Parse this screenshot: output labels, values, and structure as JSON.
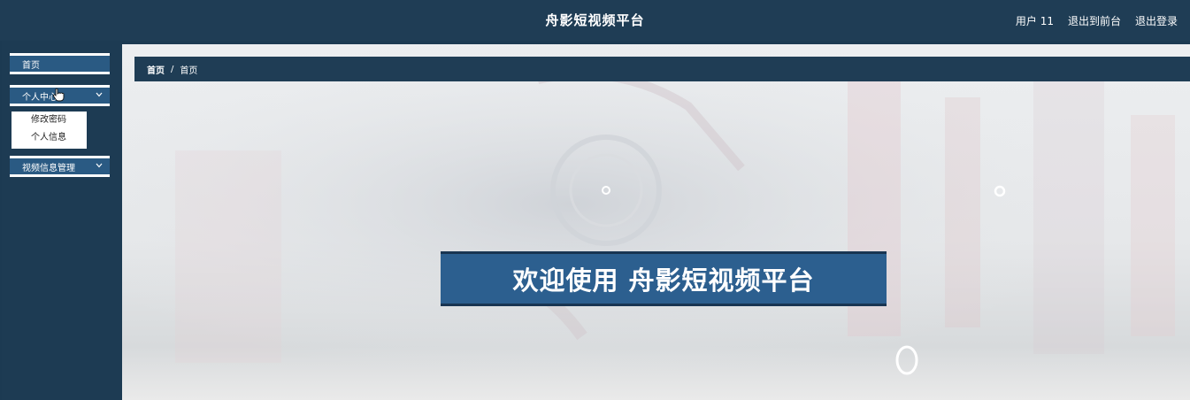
{
  "header": {
    "title": "舟影短视频平台",
    "user_label": "用户 11",
    "front_link": "退出到前台",
    "logout_link": "退出登录"
  },
  "sidebar": {
    "items": [
      {
        "label": "首页"
      },
      {
        "label": "个人中心",
        "icon": "chevron-down-icon",
        "expanded": true,
        "children": [
          {
            "label": "修改密码"
          },
          {
            "label": "个人信息"
          }
        ]
      },
      {
        "label": "视频信息管理",
        "icon": "chevron-down-icon"
      }
    ]
  },
  "breadcrumb": {
    "home": "首页",
    "separator": "/",
    "current": "首页"
  },
  "welcome": {
    "text": "欢迎使用 舟影短视频平台"
  },
  "colors": {
    "header_bg": "#1f3d55",
    "sidebar_bg": "#1d3b53",
    "menu_item_bg": "#2a5a83",
    "welcome_bg": "#2c5f8f"
  }
}
